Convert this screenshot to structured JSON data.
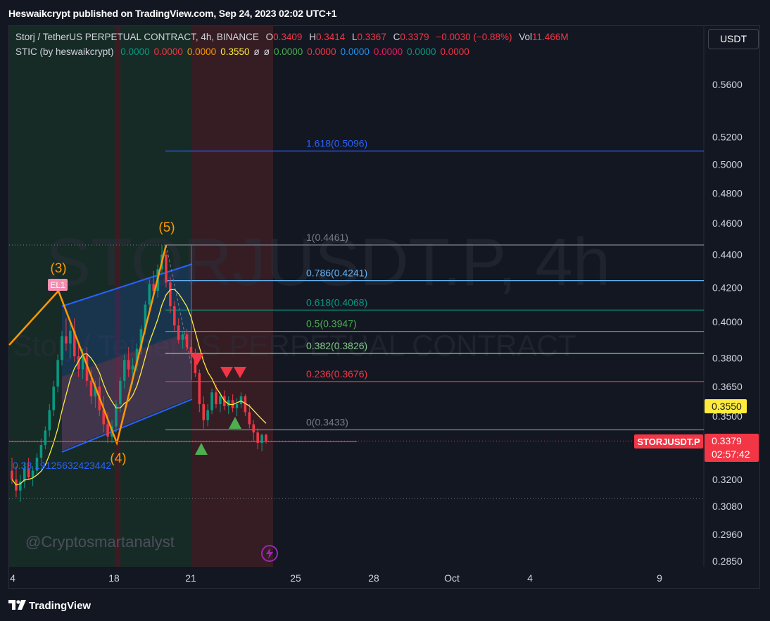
{
  "publisher": "Heswaikcrypt published on TradingView.com, Sep 24, 2023 02:02 UTC+1",
  "legend": {
    "symbol": "Storj / TetherUS PERPETUAL CONTRACT, 4h, BINANCE",
    "o_label": "O",
    "o_val": "0.3409",
    "h_label": "H",
    "h_val": "0.3414",
    "l_label": "L",
    "l_val": "0.3367",
    "c_label": "C",
    "c_val": "0.3379",
    "change": "−0.0030 (−0.88%)",
    "vol_label": "Vol",
    "vol_val": "11.466M",
    "indicator": "STIC (by heswaikcrypt)",
    "ind_values": [
      {
        "text": "0.0000",
        "color": "#089981"
      },
      {
        "text": "0.0000",
        "color": "#f23645"
      },
      {
        "text": "0.0000",
        "color": "#ff9800"
      },
      {
        "text": "0.3550",
        "color": "#ffeb3b"
      },
      {
        "text": "ø",
        "color": "#d1d4dc"
      },
      {
        "text": "ø",
        "color": "#d1d4dc"
      },
      {
        "text": "0.0000",
        "color": "#4caf50"
      },
      {
        "text": "0.0000",
        "color": "#f23645"
      },
      {
        "text": "0.0000",
        "color": "#2196f3"
      },
      {
        "text": "0.0000",
        "color": "#e91e63"
      },
      {
        "text": "0.0000",
        "color": "#089981"
      },
      {
        "text": "0.0000",
        "color": "#f23645"
      }
    ]
  },
  "currency_button": "USDT",
  "watermark": "STORJUSDT.P, 4h",
  "watermark_sub": "Storj / TetherUS PERPETUAL CONTRACT",
  "author_mark": "@Cryptosmartanalyst",
  "footer_brand": "TradingView",
  "colors": {
    "up": "#089981",
    "down": "#f23645",
    "background": "#131722",
    "accent": "#ff9800"
  },
  "chart_data": {
    "type": "candlestick",
    "symbol": "STORJUSDT.P",
    "timeframe": "4h",
    "x_ticks": [
      "4",
      "18",
      "21",
      "25",
      "28",
      "Oct",
      "4",
      "9"
    ],
    "y_axis": {
      "scale": "log",
      "ticks": [
        0.285,
        0.296,
        0.308,
        0.32,
        0.35,
        0.365,
        0.38,
        0.4,
        0.42,
        0.44,
        0.46,
        0.48,
        0.5,
        0.52,
        0.56
      ],
      "tick_labels": [
        "0.2850",
        "0.2960",
        "0.3080",
        "0.3200",
        "0.3500",
        "0.3650",
        "0.3800",
        "0.4000",
        "0.4200",
        "0.4400",
        "0.4600",
        "0.4800",
        "0.5000",
        "0.5200",
        "0.5600"
      ]
    },
    "last_price": {
      "value": 0.3379,
      "label": "0.3379",
      "countdown": "02:57:42",
      "symbol_tag": "STORJUSDT.P"
    },
    "indicator_price": {
      "value": 0.355,
      "label": "0.3550"
    },
    "fibonacci": [
      {
        "ratio": "1.618",
        "value": 0.5096,
        "label": "1.618(0.5096)",
        "color": "#2962ff"
      },
      {
        "ratio": "1",
        "value": 0.4461,
        "label": "1(0.4461)",
        "color": "#787b86"
      },
      {
        "ratio": "0.786",
        "value": 0.4241,
        "label": "0.786(0.4241)",
        "color": "#64b5f6"
      },
      {
        "ratio": "0.618",
        "value": 0.4068,
        "label": "0.618(0.4068)",
        "color": "#089981"
      },
      {
        "ratio": "0.5",
        "value": 0.3947,
        "label": "0.5(0.3947)",
        "color": "#4caf50"
      },
      {
        "ratio": "0.382",
        "value": 0.3826,
        "label": "0.382(0.3826)",
        "color": "#81c784"
      },
      {
        "ratio": "0.236",
        "value": 0.3676,
        "label": "0.236(0.3676)",
        "color": "#f23645"
      },
      {
        "ratio": "0",
        "value": 0.3433,
        "label": "0(0.3433)",
        "color": "#787b86"
      }
    ],
    "elliott_waves": [
      {
        "label": "(3)",
        "value": 0.418
      },
      {
        "label": "(4)",
        "value": 0.337
      },
      {
        "label": "(5)",
        "value": 0.4461
      }
    ],
    "el_tag": "EL1",
    "channel_label": "0.38 19125632423442",
    "candles": [
      [
        0.324,
        0.33,
        0.318,
        0.32
      ],
      [
        0.32,
        0.326,
        0.312,
        0.315
      ],
      [
        0.315,
        0.322,
        0.31,
        0.319
      ],
      [
        0.319,
        0.328,
        0.316,
        0.325
      ],
      [
        0.325,
        0.33,
        0.32,
        0.321
      ],
      [
        0.321,
        0.326,
        0.317,
        0.324
      ],
      [
        0.324,
        0.332,
        0.322,
        0.33
      ],
      [
        0.33,
        0.339,
        0.328,
        0.336
      ],
      [
        0.336,
        0.345,
        0.334,
        0.343
      ],
      [
        0.343,
        0.356,
        0.34,
        0.353
      ],
      [
        0.353,
        0.368,
        0.35,
        0.365
      ],
      [
        0.365,
        0.382,
        0.362,
        0.379
      ],
      [
        0.379,
        0.395,
        0.376,
        0.392
      ],
      [
        0.392,
        0.402,
        0.384,
        0.388
      ],
      [
        0.388,
        0.399,
        0.38,
        0.395
      ],
      [
        0.395,
        0.402,
        0.378,
        0.381
      ],
      [
        0.381,
        0.388,
        0.37,
        0.374
      ],
      [
        0.374,
        0.385,
        0.369,
        0.382
      ],
      [
        0.382,
        0.386,
        0.365,
        0.368
      ],
      [
        0.368,
        0.374,
        0.356,
        0.36
      ],
      [
        0.36,
        0.368,
        0.354,
        0.365
      ],
      [
        0.365,
        0.37,
        0.35,
        0.353
      ],
      [
        0.353,
        0.36,
        0.342,
        0.346
      ],
      [
        0.346,
        0.352,
        0.337,
        0.34
      ],
      [
        0.34,
        0.348,
        0.337,
        0.345
      ],
      [
        0.345,
        0.358,
        0.342,
        0.356
      ],
      [
        0.356,
        0.37,
        0.352,
        0.368
      ],
      [
        0.368,
        0.382,
        0.364,
        0.379
      ],
      [
        0.379,
        0.386,
        0.37,
        0.374
      ],
      [
        0.374,
        0.38,
        0.366,
        0.376
      ],
      [
        0.376,
        0.388,
        0.373,
        0.385
      ],
      [
        0.385,
        0.398,
        0.382,
        0.396
      ],
      [
        0.396,
        0.412,
        0.393,
        0.41
      ],
      [
        0.41,
        0.425,
        0.406,
        0.422
      ],
      [
        0.422,
        0.43,
        0.415,
        0.418
      ],
      [
        0.418,
        0.434,
        0.414,
        0.431
      ],
      [
        0.431,
        0.4461,
        0.428,
        0.44
      ],
      [
        0.44,
        0.442,
        0.42,
        0.423
      ],
      [
        0.423,
        0.426,
        0.405,
        0.409
      ],
      [
        0.409,
        0.412,
        0.395,
        0.398
      ],
      [
        0.398,
        0.402,
        0.388,
        0.39
      ],
      [
        0.39,
        0.395,
        0.385,
        0.393
      ],
      [
        0.393,
        0.396,
        0.384,
        0.386
      ],
      [
        0.386,
        0.39,
        0.38,
        0.383
      ],
      [
        0.383,
        0.385,
        0.37,
        0.372
      ],
      [
        0.372,
        0.374,
        0.352,
        0.356
      ],
      [
        0.356,
        0.36,
        0.344,
        0.348
      ],
      [
        0.348,
        0.356,
        0.345,
        0.353
      ],
      [
        0.353,
        0.364,
        0.351,
        0.362
      ],
      [
        0.362,
        0.366,
        0.354,
        0.356
      ],
      [
        0.356,
        0.362,
        0.352,
        0.36
      ],
      [
        0.36,
        0.363,
        0.353,
        0.355
      ],
      [
        0.355,
        0.36,
        0.351,
        0.358
      ],
      [
        0.358,
        0.361,
        0.352,
        0.354
      ],
      [
        0.354,
        0.359,
        0.35,
        0.356
      ],
      [
        0.356,
        0.362,
        0.354,
        0.36
      ],
      [
        0.36,
        0.361,
        0.35,
        0.352
      ],
      [
        0.352,
        0.356,
        0.344,
        0.346
      ],
      [
        0.346,
        0.348,
        0.338,
        0.342
      ],
      [
        0.342,
        0.344,
        0.334,
        0.337
      ],
      [
        0.337,
        0.3414,
        0.333,
        0.3409
      ],
      [
        0.3409,
        0.3414,
        0.3367,
        0.3379
      ]
    ]
  }
}
